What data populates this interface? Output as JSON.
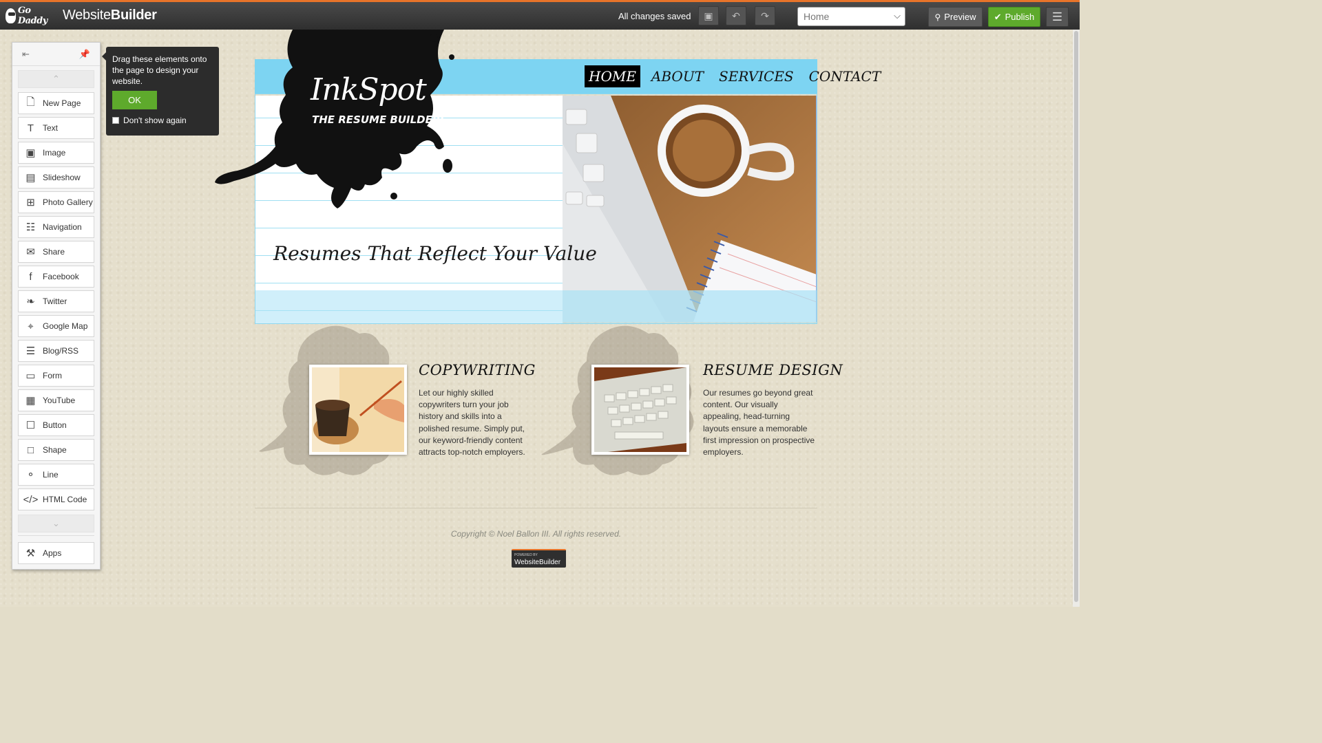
{
  "topbar": {
    "brand_logo": "Go Daddy",
    "app_title_light": "Website",
    "app_title_bold": "Builder",
    "save_status": "All changes saved",
    "page_select_value": "Home",
    "preview_label": "Preview",
    "publish_label": "Publish"
  },
  "toolbox": {
    "items": [
      {
        "label": "New Page",
        "icon": "new-page-icon"
      },
      {
        "label": "Text",
        "icon": "text-icon"
      },
      {
        "label": "Image",
        "icon": "image-icon"
      },
      {
        "label": "Slideshow",
        "icon": "slideshow-icon"
      },
      {
        "label": "Photo Gallery",
        "icon": "photo-gallery-icon"
      },
      {
        "label": "Navigation",
        "icon": "navigation-icon"
      },
      {
        "label": "Share",
        "icon": "share-icon"
      },
      {
        "label": "Facebook",
        "icon": "facebook-icon"
      },
      {
        "label": "Twitter",
        "icon": "twitter-icon"
      },
      {
        "label": "Google Map",
        "icon": "map-icon"
      },
      {
        "label": "Blog/RSS",
        "icon": "blog-icon"
      },
      {
        "label": "Form",
        "icon": "form-icon"
      },
      {
        "label": "YouTube",
        "icon": "youtube-icon"
      },
      {
        "label": "Button",
        "icon": "button-icon"
      },
      {
        "label": "Shape",
        "icon": "shape-icon"
      },
      {
        "label": "Line",
        "icon": "line-icon"
      },
      {
        "label": "HTML Code",
        "icon": "html-code-icon"
      }
    ],
    "apps_label": "Apps"
  },
  "tooltip": {
    "text": "Drag these elements onto the page to design your website.",
    "ok_label": "OK",
    "dont_show_label": "Don't show again"
  },
  "site": {
    "logo_title": "InkSpot",
    "logo_subtitle": "THE RESUME BUILDERS",
    "nav": [
      "HOME",
      "ABOUT",
      "SERVICES",
      "CONTACT"
    ],
    "tagline": "Resumes That Reflect Your Value",
    "services": [
      {
        "title": "COPYWRITING",
        "text": "Let our highly skilled copywriters turn your job history and skills into a polished resume. Simply put, our keyword-friendly content attracts top-notch employers."
      },
      {
        "title": "RESUME DESIGN",
        "text": "Our resumes go beyond great content. Our visually appealing, head-turning layouts ensure a memorable first impression on prospective employers."
      }
    ],
    "copyright": "Copyright © Noel Ballon III. All rights reserved.",
    "badge_small": "POWERED BY",
    "badge_big": "WebsiteBuilder"
  },
  "colors": {
    "accent_orange": "#e8742a",
    "publish_green": "#5eaa2c",
    "header_blue": "#7dd4f2"
  }
}
